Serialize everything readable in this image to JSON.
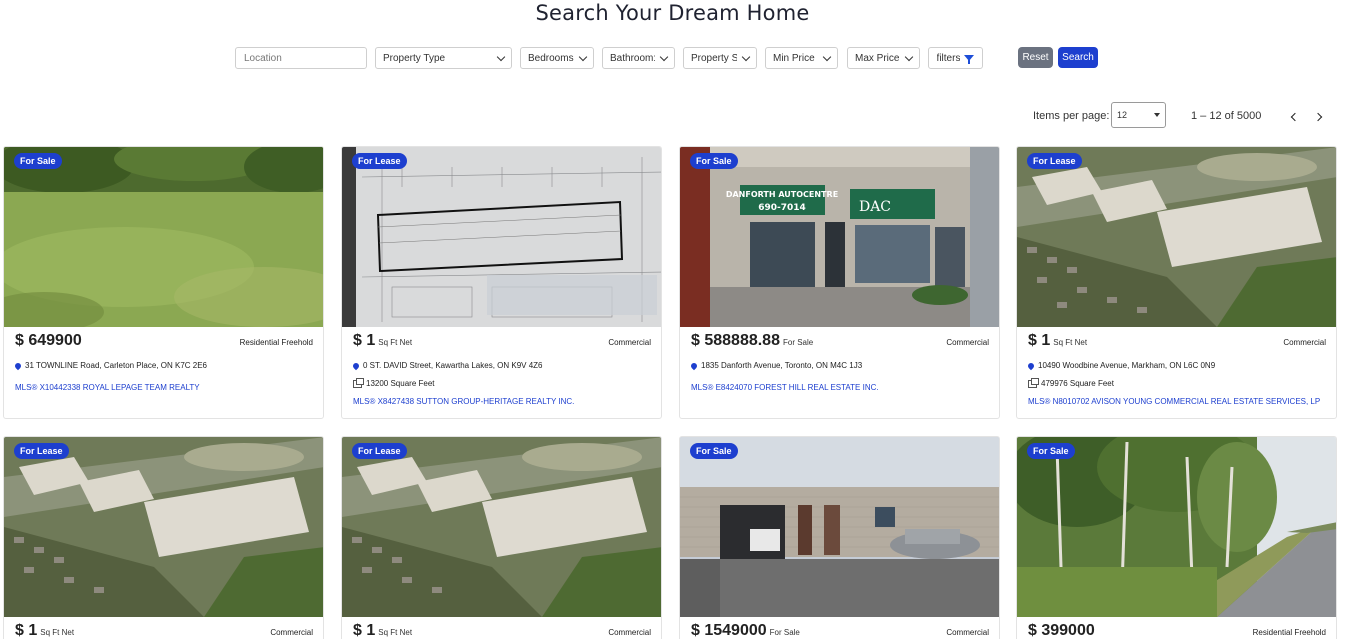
{
  "page": {
    "title": "Search Your Dream Home"
  },
  "filters": {
    "location_placeholder": "Location",
    "property_type": "Property Type",
    "bedrooms": "Bedrooms",
    "bathrooms": "Bathroom:",
    "property_status": "Property S",
    "min_price": "Min Price",
    "max_price": "Max Price",
    "filters": "filters",
    "reset": "Reset",
    "search": "Search"
  },
  "pagination": {
    "items_per_page_label": "Items per page:",
    "items_per_page_value": "12",
    "range": "1 – 12 of 5000"
  },
  "colors": {
    "accent": "#1d3fcf",
    "reset": "#6b7280"
  },
  "listings": [
    {
      "badge": "For Sale",
      "price": "$ 649900",
      "unit": "",
      "type": "Residential Freehold",
      "address": "31 TOWNLINE Road, Carleton Place, ON K7C 2E6",
      "sqft": "",
      "mls": "MLS® X10442338 ROYAL LEPAGE TEAM REALTY"
    },
    {
      "badge": "For Lease",
      "price": "$ 1",
      "unit": "Sq Ft Net",
      "type": "Commercial",
      "address": "0 ST. DAVID Street, Kawartha Lakes, ON K9V 4Z6",
      "sqft": "13200 Square Feet",
      "mls": "MLS® X8427438 SUTTON GROUP-HERITAGE REALTY INC."
    },
    {
      "badge": "For Sale",
      "price": "$ 588888.88",
      "unit": "For Sale",
      "type": "Commercial",
      "address": "1835 Danforth Avenue, Toronto, ON M4C 1J3",
      "sqft": "",
      "mls": "MLS® E8424070 FOREST HILL REAL ESTATE INC."
    },
    {
      "badge": "For Lease",
      "price": "$ 1",
      "unit": "Sq Ft Net",
      "type": "Commercial",
      "address": "10490 Woodbine Avenue, Markham, ON L6C 0N9",
      "sqft": "479976 Square Feet",
      "mls": "MLS® N8010702 AVISON YOUNG COMMERCIAL REAL ESTATE SERVICES, LP"
    },
    {
      "badge": "For Lease",
      "price": "$ 1",
      "unit": "Sq Ft Net",
      "type": "Commercial"
    },
    {
      "badge": "For Lease",
      "price": "$ 1",
      "unit": "Sq Ft Net",
      "type": "Commercial"
    },
    {
      "badge": "For Sale",
      "price": "$ 1549000",
      "unit": "For Sale",
      "type": "Commercial"
    },
    {
      "badge": "For Sale",
      "price": "$ 399000",
      "unit": "",
      "type": "Residential Freehold"
    }
  ],
  "sign_text": {
    "store_name": "DANFORTH AUTOCENTRE",
    "phone": "690-7014",
    "logo": "DAC"
  }
}
